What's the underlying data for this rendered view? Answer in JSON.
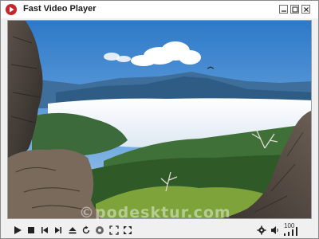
{
  "window": {
    "title": "Fast Video Player",
    "controls": [
      "minimize-icon",
      "maximize-icon",
      "close-icon"
    ]
  },
  "video": {
    "watermark": "©podesktur.com"
  },
  "controls": {
    "buttons": [
      "play",
      "stop",
      "previous",
      "next",
      "eject",
      "replay",
      "info",
      "fullscreen-toggle",
      "expand"
    ],
    "right_buttons": [
      "settings",
      "volume"
    ],
    "volume_level": "100",
    "volume_fraction": 1.0
  },
  "colors": {
    "app_icon": "#c8252b",
    "titlebar": "#ffffff",
    "frame": "#f0f0f0",
    "icon": "#222222"
  }
}
